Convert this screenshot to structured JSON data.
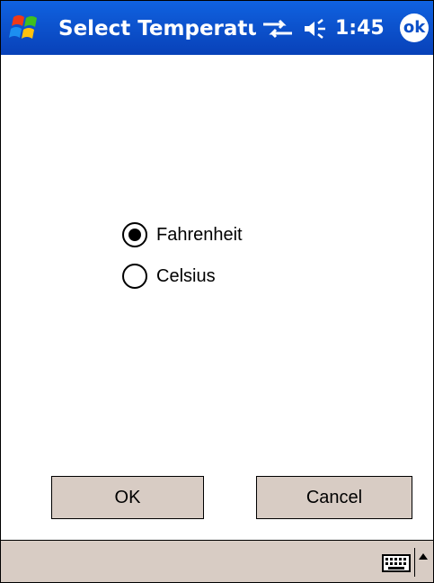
{
  "titlebar": {
    "title": "Select Temperature",
    "time": "1:45",
    "ok_label": "ok",
    "start_icon": "windows-flag-icon",
    "connectivity_icon": "connectivity-icon",
    "volume_icon": "volume-icon",
    "color": "#0b4fc8"
  },
  "options": {
    "selected": "Fahrenheit",
    "items": [
      {
        "label": "Fahrenheit",
        "checked": true
      },
      {
        "label": "Celsius",
        "checked": false
      }
    ]
  },
  "buttons": {
    "ok_label": "OK",
    "cancel_label": "Cancel",
    "color": "#d8ccc4"
  },
  "menubar": {
    "keyboard_icon": "keyboard-icon",
    "sip_arrow_icon": "input-panel-arrow-icon"
  }
}
